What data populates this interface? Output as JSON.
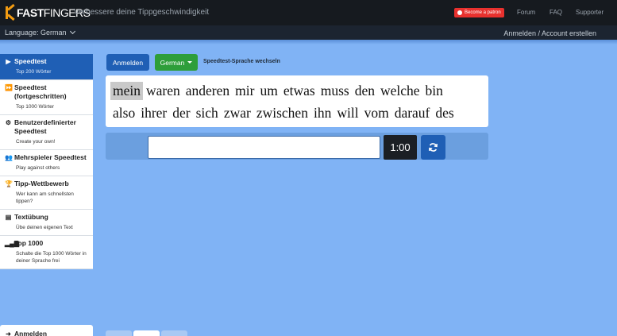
{
  "header": {
    "logo_prefix": "",
    "logo_bold": "FAST",
    "logo_thin": "FINGERS",
    "tagline": "Verbessere deine Tippgeschwindigkeit",
    "patron_label": "Become a patron",
    "links": [
      "Forum",
      "FAQ",
      "Supporter"
    ]
  },
  "subbar": {
    "language_label": "Language: German",
    "login_link": "Anmelden / Account erstellen"
  },
  "sidebar": {
    "items": [
      {
        "icon": "play-icon",
        "title": "Speedtest",
        "sub": "Top 200 Wörter",
        "active": true
      },
      {
        "icon": "forward-icon",
        "title": "Speedtest (fortgeschritten)",
        "sub": "Top 1000 Wörter",
        "active": false
      },
      {
        "icon": "cogs-icon",
        "title": "Benutzerdefinierter Speedtest",
        "sub": "Create your own!",
        "active": false
      },
      {
        "icon": "users-icon",
        "title": "Mehrspieler Speedtest",
        "sub": "Play against others",
        "active": false
      },
      {
        "icon": "trophy-icon",
        "title": "Tipp-Wettbewerb",
        "sub": "Wer kann am schnellsten tippen?",
        "active": false
      },
      {
        "icon": "file-icon",
        "title": "Textübung",
        "sub": "Übe deinen eigenen Text",
        "active": false
      },
      {
        "icon": "signal-icon",
        "title": "Top 1000",
        "sub": "Schalte die Top 1000 Wörter in deiner Sprache frei",
        "active": false
      }
    ],
    "bottom_label": "Anmelden"
  },
  "toolbar": {
    "login_button": "Anmelden",
    "language_button": "German",
    "change_language": "Speedtest-Sprache wechseln"
  },
  "words": {
    "line1": [
      "mein",
      "waren",
      "anderen",
      "mir",
      "um",
      "etwas",
      "muss",
      "den",
      "welche",
      "bin"
    ],
    "line2": [
      "also",
      "ihrer",
      "der",
      "sich",
      "zwar",
      "zwischen",
      "ihn",
      "will",
      "vom",
      "darauf",
      "des"
    ],
    "current_index": 0
  },
  "test": {
    "input_value": "",
    "timer": "1:00"
  },
  "colors": {
    "background": "#80b3f5",
    "primary": "#1f5fb5",
    "success": "#2e9e3a",
    "patron": "#e8312e",
    "logo_accent": "#f39c12"
  }
}
